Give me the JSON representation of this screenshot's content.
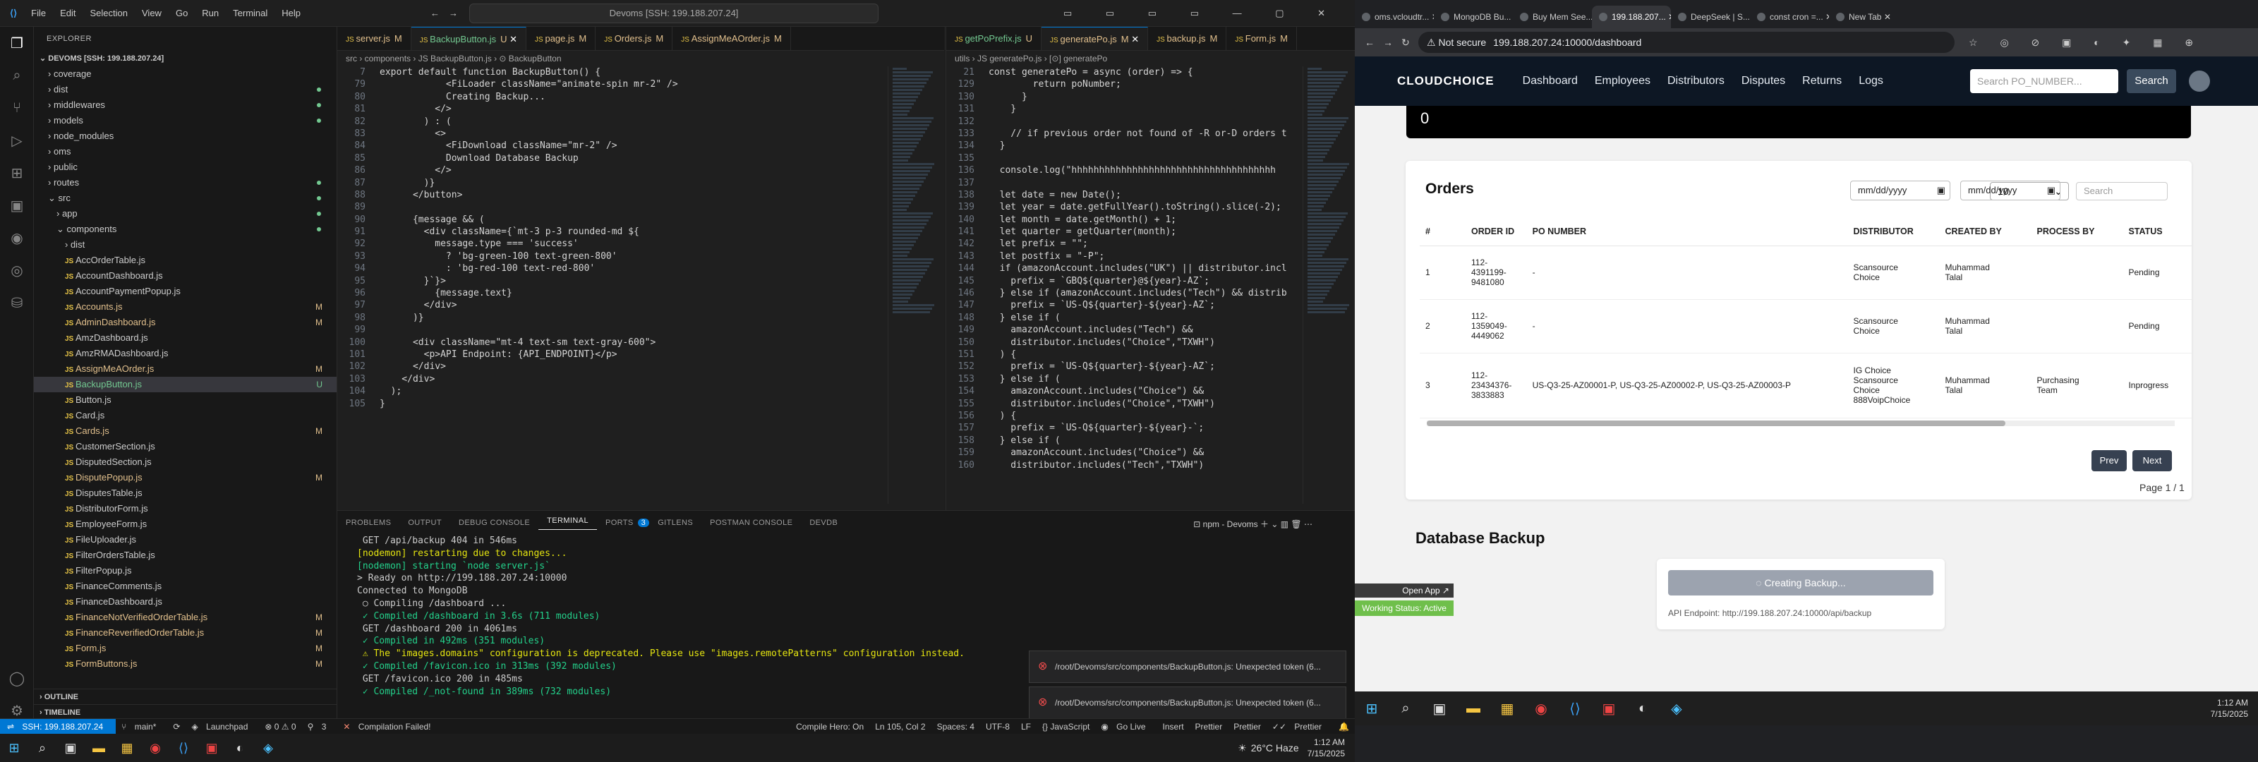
{
  "vscode": {
    "menu": [
      "File",
      "Edit",
      "Selection",
      "View",
      "Go",
      "Run",
      "Terminal",
      "Help"
    ],
    "command_center": "Devoms [SSH: 199.188.207.24]",
    "explorer_title": "EXPLORER",
    "root": "DEVOMS [SSH: 199.188.207.24]",
    "tree": [
      {
        "name": "coverage",
        "kind": "folder",
        "depth": 1
      },
      {
        "name": "dist",
        "kind": "folder",
        "depth": 1,
        "dot": true
      },
      {
        "name": "middlewares",
        "kind": "folder",
        "depth": 1,
        "dot": true
      },
      {
        "name": "models",
        "kind": "folder",
        "depth": 1,
        "dot": true
      },
      {
        "name": "node_modules",
        "kind": "folder",
        "depth": 1
      },
      {
        "name": "oms",
        "kind": "folder",
        "depth": 1
      },
      {
        "name": "public",
        "kind": "folder",
        "depth": 1
      },
      {
        "name": "routes",
        "kind": "folder",
        "depth": 1,
        "dot": true
      },
      {
        "name": "src",
        "kind": "folder-open",
        "depth": 1,
        "dot": true
      },
      {
        "name": "app",
        "kind": "folder",
        "depth": 2,
        "dot": true
      },
      {
        "name": "components",
        "kind": "folder-open",
        "depth": 2,
        "dot": true
      },
      {
        "name": "dist",
        "kind": "folder",
        "depth": 3
      },
      {
        "name": "AccOrderTable.js",
        "depth": 3
      },
      {
        "name": "AccountDashboard.js",
        "depth": 3
      },
      {
        "name": "AccountPaymentPopup.js",
        "depth": 3
      },
      {
        "name": "Accounts.js",
        "depth": 3,
        "status": "M"
      },
      {
        "name": "AdminDashboard.js",
        "depth": 3,
        "status": "M"
      },
      {
        "name": "AmzDashboard.js",
        "depth": 3
      },
      {
        "name": "AmzRMADashboard.js",
        "depth": 3
      },
      {
        "name": "AssignMeAOrder.js",
        "depth": 3,
        "status": "M"
      },
      {
        "name": "BackupButton.js",
        "depth": 3,
        "status": "U",
        "selected": true
      },
      {
        "name": "Button.js",
        "depth": 3
      },
      {
        "name": "Card.js",
        "depth": 3
      },
      {
        "name": "Cards.js",
        "depth": 3,
        "status": "M"
      },
      {
        "name": "CustomerSection.js",
        "depth": 3
      },
      {
        "name": "DisputedSection.js",
        "depth": 3
      },
      {
        "name": "DisputePopup.js",
        "depth": 3,
        "status": "M"
      },
      {
        "name": "DisputesTable.js",
        "depth": 3
      },
      {
        "name": "DistributorForm.js",
        "depth": 3
      },
      {
        "name": "EmployeeForm.js",
        "depth": 3
      },
      {
        "name": "FileUploader.js",
        "depth": 3
      },
      {
        "name": "FilterOrdersTable.js",
        "depth": 3
      },
      {
        "name": "FilterPopup.js",
        "depth": 3
      },
      {
        "name": "FinanceComments.js",
        "depth": 3
      },
      {
        "name": "FinanceDashboard.js",
        "depth": 3
      },
      {
        "name": "FinanceNotVerifiedOrderTable.js",
        "depth": 3,
        "status": "M"
      },
      {
        "name": "FinanceReverifiedOrderTable.js",
        "depth": 3,
        "status": "M"
      },
      {
        "name": "Form.js",
        "depth": 3,
        "status": "M"
      },
      {
        "name": "FormButtons.js",
        "depth": 3,
        "status": "M"
      }
    ],
    "outline": "OUTLINE",
    "timeline": "TIMELINE",
    "tabs_left": [
      {
        "label": "server.js",
        "mark": "M"
      },
      {
        "label": "BackupButton.js",
        "mark": "U",
        "active": true
      },
      {
        "label": "page.js",
        "mark": "M"
      },
      {
        "label": "Orders.js",
        "mark": "M"
      },
      {
        "label": "AssignMeAOrder.js",
        "mark": "M"
      }
    ],
    "tabs_right": [
      {
        "label": "getPoPrefix.js",
        "mark": "U"
      },
      {
        "label": "generatePo.js",
        "mark": "M",
        "active": true
      },
      {
        "label": "backup.js",
        "mark": "M"
      },
      {
        "label": "Form.js",
        "mark": "M"
      }
    ],
    "breadcrumb_left": "src › components › JS BackupButton.js › ⊙ BackupButton",
    "breadcrumb_right": "utils › JS generatePo.js › [⊙] generatePo",
    "code_left": [
      [
        "7",
        "export default function BackupButton() {"
      ],
      [
        "79",
        "            <FiLoader className=\"animate-spin mr-2\" />"
      ],
      [
        "80",
        "            Creating Backup..."
      ],
      [
        "81",
        "          </>"
      ],
      [
        "82",
        "        ) : ("
      ],
      [
        "83",
        "          <>"
      ],
      [
        "84",
        "            <FiDownload className=\"mr-2\" />"
      ],
      [
        "85",
        "            Download Database Backup"
      ],
      [
        "86",
        "          </>"
      ],
      [
        "87",
        "        )}"
      ],
      [
        "88",
        "      </button>"
      ],
      [
        "89",
        ""
      ],
      [
        "90",
        "      {message && ("
      ],
      [
        "91",
        "        <div className={`mt-3 p-3 rounded-md ${"
      ],
      [
        "92",
        "          message.type === 'success'"
      ],
      [
        "93",
        "            ? 'bg-green-100 text-green-800'"
      ],
      [
        "94",
        "            : 'bg-red-100 text-red-800'"
      ],
      [
        "95",
        "        }`}>"
      ],
      [
        "96",
        "          {message.text}"
      ],
      [
        "97",
        "        </div>"
      ],
      [
        "98",
        "      )}"
      ],
      [
        "99",
        ""
      ],
      [
        "100",
        "      <div className=\"mt-4 text-sm text-gray-600\">"
      ],
      [
        "101",
        "        <p>API Endpoint: {API_ENDPOINT}</p>"
      ],
      [
        "102",
        "      </div>"
      ],
      [
        "103",
        "    </div>"
      ],
      [
        "104",
        "  );"
      ],
      [
        "105",
        "}"
      ]
    ],
    "code_right": [
      [
        "21",
        "const generatePo = async (order) => {"
      ],
      [
        "129",
        "        return poNumber;"
      ],
      [
        "130",
        "      }"
      ],
      [
        "131",
        "    }"
      ],
      [
        "132",
        ""
      ],
      [
        "133",
        "    // if previous order not found of -R or-D orders t"
      ],
      [
        "134",
        "  }"
      ],
      [
        "135",
        ""
      ],
      [
        "136",
        "  console.log(\"hhhhhhhhhhhhhhhhhhhhhhhhhhhhhhhhhhhhh"
      ],
      [
        "137",
        ""
      ],
      [
        "138",
        "  let date = new Date();"
      ],
      [
        "139",
        "  let year = date.getFullYear().toString().slice(-2);"
      ],
      [
        "140",
        "  let month = date.getMonth() + 1;"
      ],
      [
        "141",
        "  let quarter = getQuarter(month);"
      ],
      [
        "142",
        "  let prefix = \"\";"
      ],
      [
        "143",
        "  let postfix = \"-P\";"
      ],
      [
        "144",
        "  if (amazonAccount.includes(\"UK\") || distributor.incl"
      ],
      [
        "145",
        "    prefix = `GBQ${quarter}@${year}-AZ`;"
      ],
      [
        "146",
        "  } else if (amazonAccount.includes(\"Tech\") && distrib"
      ],
      [
        "147",
        "    prefix = `US-Q${quarter}-${year}-AZ`;"
      ],
      [
        "148",
        "  } else if ("
      ],
      [
        "149",
        "    amazonAccount.includes(\"Tech\") &&"
      ],
      [
        "150",
        "    distributor.includes(\"Choice\",\"TXWH\")"
      ],
      [
        "151",
        "  ) {"
      ],
      [
        "152",
        "    prefix = `US-Q${quarter}-${year}-AZ`;"
      ],
      [
        "153",
        "  } else if ("
      ],
      [
        "154",
        "    amazonAccount.includes(\"Choice\") &&"
      ],
      [
        "155",
        "    distributor.includes(\"Choice\",\"TXWH\")"
      ],
      [
        "156",
        "  ) {"
      ],
      [
        "157",
        "    prefix = `US-Q${quarter}-${year}-`;"
      ],
      [
        "158",
        "  } else if ("
      ],
      [
        "159",
        "    amazonAccount.includes(\"Choice\") &&"
      ],
      [
        "160",
        "    distributor.includes(\"Tech\",\"TXWH\")"
      ]
    ],
    "panel_tabs": [
      "PROBLEMS",
      "OUTPUT",
      "DEBUG CONSOLE",
      "TERMINAL",
      "PORTS",
      "GITLENS",
      "POSTMAN CONSOLE",
      "DEVDB"
    ],
    "ports_badge": "3",
    "terminal_label": "npm - Devoms",
    "terminal": [
      " GET /api/backup 404 in 546ms",
      "[nodemon] restarting due to changes...",
      "[nodemon] starting `node server.js`",
      "> Ready on http://199.188.207.24:10000",
      "Connected to MongoDB",
      " ○ Compiling /dashboard ...",
      " ✓ Compiled /dashboard in 3.6s (711 modules)",
      " GET /dashboard 200 in 4061ms",
      " ✓ Compiled in 492ms (351 modules)",
      " ⚠ The \"images.domains\" configuration is deprecated. Please use \"images.remotePatterns\" configuration instead.",
      " ✓ Compiled /favicon.ico in 313ms (392 modules)",
      " GET /favicon.ico 200 in 485ms",
      " ✓ Compiled /_not-found in 389ms (732 modules)"
    ],
    "error_toast": "/root/Devoms/src/components/BackupButton.js: Unexpected token (6...",
    "status": {
      "remote": "SSH: 199.188.207.24",
      "branch": "main*",
      "sync": "⟳",
      "launchpad": "Launchpad",
      "problems": "⊗ 0 ⚠ 0",
      "ports": "3",
      "compile_failed": "Compilation Failed!",
      "compile_hero": "Compile Hero: On",
      "cursor": "Ln 105, Col 2",
      "spaces": "Spaces: 4",
      "encoding": "UTF-8",
      "eol": "LF",
      "lang": "{} JavaScript",
      "golive": "Go Live",
      "insert": "Insert",
      "prettier1": "Prettier",
      "prettier2": "Prettier",
      "prettier3": "Prettier"
    },
    "weather": "26°C  Haze",
    "clock_time": "1:12 AM",
    "clock_date": "7/15/2025"
  },
  "chrome": {
    "tabs": [
      "oms.vcloudtr...",
      "MongoDB Bu...",
      "Buy Mem See...",
      "199.188.207...",
      "DeepSeek | S...",
      "const cron =...",
      "New Tab"
    ],
    "active_tab": 3,
    "not_secure": "Not secure",
    "url": "199.188.207.24:10000/dashboard"
  },
  "app": {
    "logo": "CLOUDCHOICE",
    "nav": [
      "Dashboard",
      "Employees",
      "Distributors",
      "Disputes",
      "Returns",
      "Logs"
    ],
    "search_placeholder": "Search PO_NUMBER...",
    "search_btn": "Search",
    "count": "0",
    "orders_title": "Orders",
    "date_ph": "mm/dd/yyyy",
    "page_size": "10",
    "search2": "Search",
    "columns": [
      "#",
      "ORDER ID",
      "PO NUMBER",
      "DISTRIBUTOR",
      "CREATED BY",
      "PROCESS BY",
      "STATUS"
    ],
    "rows": [
      {
        "n": "1",
        "order": "112-\n4391199-\n9481080",
        "po": "-",
        "dist": "Scansource\nChoice",
        "by": "Muhammad\nTalal",
        "proc": "",
        "status": "Pending"
      },
      {
        "n": "2",
        "order": "112-\n1359049-\n4449062",
        "po": "-",
        "dist": "Scansource\nChoice",
        "by": "Muhammad\nTalal",
        "proc": "",
        "status": "Pending"
      },
      {
        "n": "3",
        "order": "112-\n23434376-\n3833883",
        "po": "US-Q3-25-AZ00001-P, US-Q3-25-AZ00002-P, US-Q3-25-AZ00003-P",
        "dist": "IG Choice\nScansource\nChoice\n888VoipChoice",
        "by": "Muhammad\nTalal",
        "proc": "Purchasing\nTeam",
        "status": "Inprogress"
      }
    ],
    "prev": "Prev",
    "next": "Next",
    "page_of": "Page 1 / 1",
    "db_title": "Database Backup",
    "db_btn": "Creating Backup...",
    "db_api": "API Endpoint: http://199.188.207.24:10000/api/backup",
    "toast_open": "Open App ↗",
    "toast_status": "Working Status: Active"
  },
  "win": {
    "time": "1:12 AM",
    "date": "7/15/2025"
  }
}
